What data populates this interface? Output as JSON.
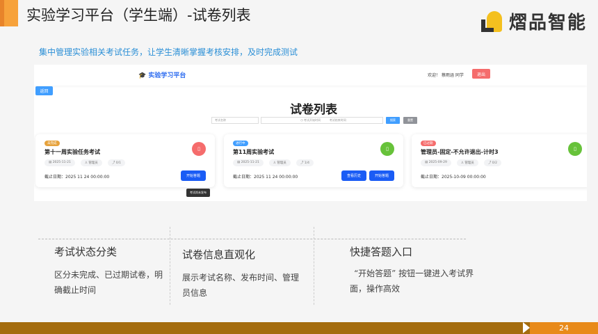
{
  "slide": {
    "title": "实验学习平台（学生端）-试卷列表",
    "subtitle": "集中管理实验相关考试任务，让学生清晰掌握考核安排，及时完成测试",
    "logo_text": "熠品智能",
    "page": "24",
    "accent": "#f7a23b"
  },
  "app": {
    "brand": "实验学习平台",
    "welcome": "欢迎！ 蔡雨涵 同学",
    "logout": "退出",
    "back": "返回",
    "page_title": "试卷列表",
    "search": {
      "name_placeholder": "考试名称",
      "start_placeholder": "考试开始时间",
      "end_placeholder": "考试结束时间",
      "search": "搜索",
      "reset": "重置"
    },
    "cards": [
      {
        "badge": "未完成",
        "badge_color": "#e6a23c",
        "title": "第十一周实验任务考试",
        "date": "2025-11-21",
        "creator": "管理员",
        "count": "0/1",
        "deadline": "截止日期：2025 11 24 00:00:00",
        "icon_color": "#f56c6c",
        "buttons": [
          "开始答题"
        ]
      },
      {
        "badge": "进行中",
        "badge_color": "#409eff",
        "title": "第11周实验考试",
        "date": "2025-11-21",
        "creator": "管理员",
        "count": "1/4",
        "deadline": "截止日期：2025 11 24 00:00:00",
        "icon_color": "#67c23a",
        "buttons": [
          "查看历史",
          "开始答题"
        ]
      },
      {
        "badge": "已过期",
        "badge_color": "#f56c6c",
        "title": "管理员-固定-不允许退出-计时3",
        "date": "2025-09-29",
        "creator": "管理员",
        "count": "0/2",
        "deadline": "截止日期：2025-10-09 00:00:00",
        "icon_color": "#67c23a",
        "buttons": []
      }
    ],
    "tooltip": "考试尚未发布"
  },
  "features": [
    {
      "title": "考试状态分类",
      "desc": "区分未完成、已过期试卷，明确截止时间"
    },
    {
      "title": "试卷信息直观化",
      "desc": "展示考试名称、发布时间、管理员信息"
    },
    {
      "title": "快捷答题入口",
      "desc": "“开始答题” 按钮一键进入考试界面，操作高效"
    }
  ]
}
